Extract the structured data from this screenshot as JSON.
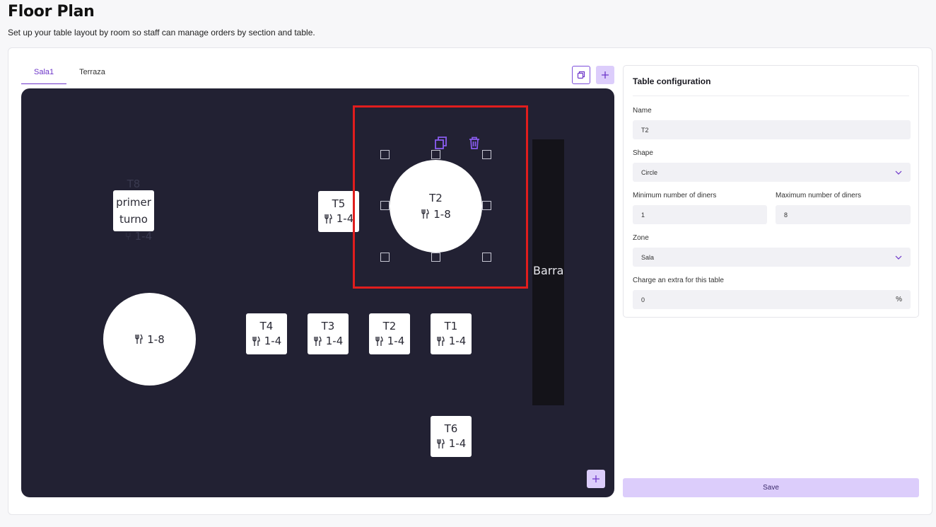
{
  "header": {
    "title": "Floor Plan",
    "subtitle": "Set up your table layout by room so staff can manage orders by section and table."
  },
  "tabs": [
    {
      "label": "Sala1",
      "active": true
    },
    {
      "label": "Terraza",
      "active": false
    }
  ],
  "toolbar": {
    "copy_room_icon": "copy-icon",
    "add_room_icon": "plus-icon"
  },
  "floor": {
    "tables": [
      {
        "id": "t8",
        "name": "T8",
        "label": "primer turno",
        "capacity": "1-4",
        "shape": "square"
      },
      {
        "id": "t5",
        "name": "T5",
        "capacity": "1-4",
        "shape": "square"
      },
      {
        "id": "t2-selected",
        "name": "T2",
        "capacity": "1-8",
        "shape": "circle",
        "selected": true
      },
      {
        "id": "round-unnamed",
        "name": "",
        "capacity": "1-8",
        "shape": "circle"
      },
      {
        "id": "t4",
        "name": "T4",
        "capacity": "1-4",
        "shape": "square"
      },
      {
        "id": "t3",
        "name": "T3",
        "capacity": "1-4",
        "shape": "square"
      },
      {
        "id": "t2",
        "name": "T2",
        "capacity": "1-4",
        "shape": "square"
      },
      {
        "id": "t1",
        "name": "T1",
        "capacity": "1-4",
        "shape": "square"
      },
      {
        "id": "t6",
        "name": "T6",
        "capacity": "1-4",
        "shape": "square"
      }
    ],
    "bar_label": "Barra",
    "selection_actions": [
      "duplicate-icon",
      "trash-icon"
    ],
    "capacity_icon": "cutlery-icon",
    "add_table_icon": "plus-icon"
  },
  "config": {
    "title": "Table configuration",
    "name_label": "Name",
    "name_value": "T2",
    "shape_label": "Shape",
    "shape_value": "Circle",
    "min_label": "Minimum number of diners",
    "min_value": "1",
    "max_label": "Maximum number of diners",
    "max_value": "8",
    "zone_label": "Zone",
    "zone_value": "Sala",
    "extra_label": "Charge an extra for this table",
    "extra_value": "0",
    "extra_unit": "%"
  },
  "actions": {
    "save_label": "Save"
  },
  "colors": {
    "accent": "#6d35c9",
    "accent_light": "#dccdfb",
    "canvas": "#222133",
    "selection": "#e11d1d"
  }
}
